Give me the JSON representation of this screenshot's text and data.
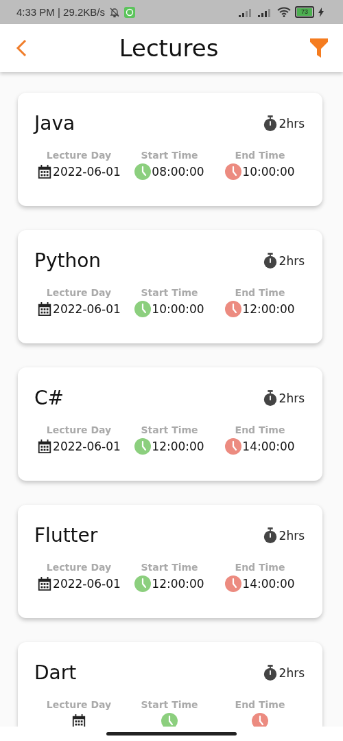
{
  "status_bar": {
    "time": "4:33 PM | 29.2KB/s",
    "battery": "73"
  },
  "header": {
    "title": "Lectures"
  },
  "lectures": [
    {
      "name": "Java",
      "duration": "2hrs",
      "day_label": "Lecture Day",
      "day": "2022-06-01",
      "start_label": "Start Time",
      "start": "08:00:00",
      "end_label": "End Time",
      "end": "10:00:00"
    },
    {
      "name": "Python",
      "duration": "2hrs",
      "day_label": "Lecture Day",
      "day": "2022-06-01",
      "start_label": "Start Time",
      "start": "10:00:00",
      "end_label": "End Time",
      "end": "12:00:00"
    },
    {
      "name": "C#",
      "duration": "2hrs",
      "day_label": "Lecture Day",
      "day": "2022-06-01",
      "start_label": "Start Time",
      "start": "12:00:00",
      "end_label": "End Time",
      "end": "14:00:00"
    },
    {
      "name": "Flutter",
      "duration": "2hrs",
      "day_label": "Lecture Day",
      "day": "2022-06-01",
      "start_label": "Start Time",
      "start": "12:00:00",
      "end_label": "End Time",
      "end": "14:00:00"
    },
    {
      "name": "Dart",
      "duration": "2hrs",
      "day_label": "Lecture Day",
      "start_label": "Start Time",
      "end_label": "End Time"
    }
  ]
}
